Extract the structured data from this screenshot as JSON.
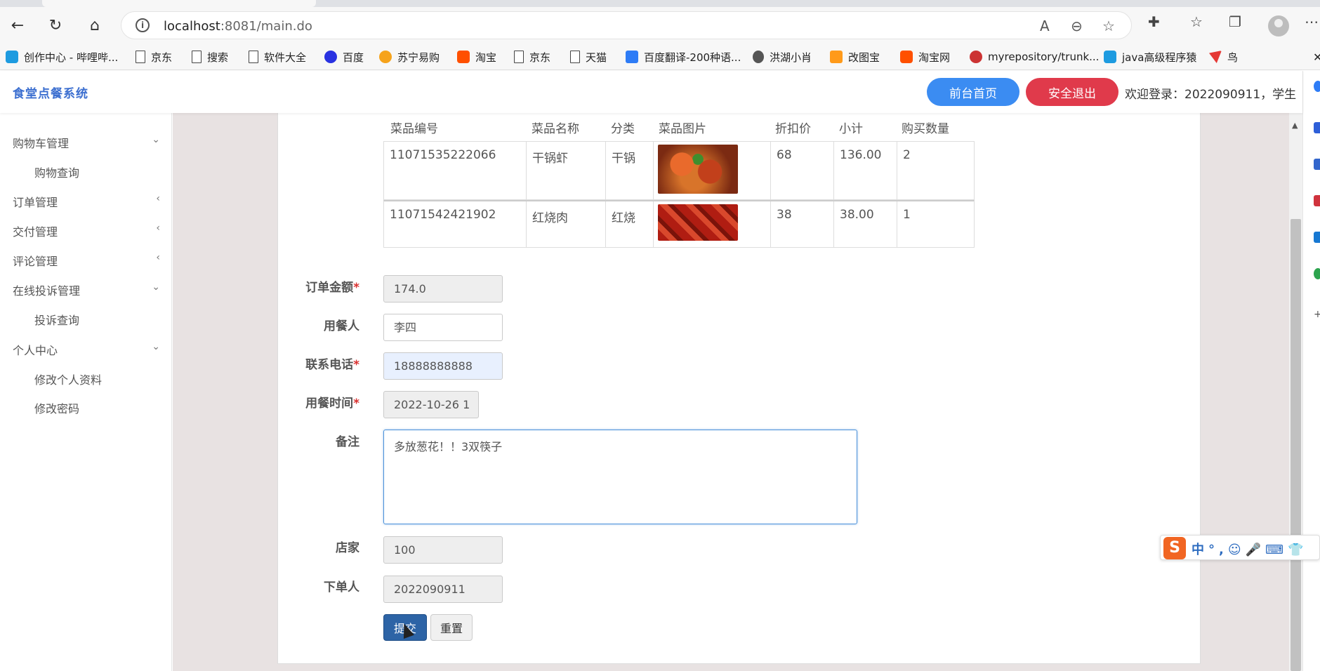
{
  "browser": {
    "url_host": "localhost",
    "url_path": ":8081/main.do",
    "bookmarks": [
      {
        "label": "创作中心 - 哔哩哔...",
        "icon": "bilibili-icon"
      },
      {
        "label": "京东",
        "icon": "page-icon"
      },
      {
        "label": "搜索",
        "icon": "page-icon"
      },
      {
        "label": "软件大全",
        "icon": "page-icon"
      },
      {
        "label": "百度",
        "icon": "baidu-icon"
      },
      {
        "label": "苏宁易购",
        "icon": "suning-icon"
      },
      {
        "label": "淘宝",
        "icon": "taobao-icon"
      },
      {
        "label": "京东",
        "icon": "page-icon"
      },
      {
        "label": "天猫",
        "icon": "page-icon"
      },
      {
        "label": "百度翻译-200种语...",
        "icon": "fanyi-icon"
      },
      {
        "label": "洪湖小肖",
        "icon": "hh-icon"
      },
      {
        "label": "改图宝",
        "icon": "gaitubao-icon"
      },
      {
        "label": "淘宝网",
        "icon": "taobao-icon"
      },
      {
        "label": "myrepository/trunk...",
        "icon": "git-icon"
      },
      {
        "label": "java高级程序猿",
        "icon": "bilibili-icon"
      },
      {
        "label": "鸟",
        "icon": "bird-icon"
      }
    ]
  },
  "header": {
    "title": "食堂点餐系统",
    "front_button": "前台首页",
    "logout_button": "安全退出",
    "welcome": "欢迎登录：2022090911，学生"
  },
  "sidebar": {
    "items": [
      {
        "label": "购物车管理",
        "chevron": "⌄"
      },
      {
        "label": "购物查询",
        "sub": true
      },
      {
        "label": "订单管理",
        "chevron": "‹"
      },
      {
        "label": "交付管理",
        "chevron": "‹"
      },
      {
        "label": "评论管理",
        "chevron": "‹"
      },
      {
        "label": "在线投诉管理",
        "chevron": "⌄"
      },
      {
        "label": "投诉查询",
        "sub": true
      },
      {
        "label": "个人中心",
        "chevron": "⌄"
      },
      {
        "label": "修改个人资料",
        "sub": true
      },
      {
        "label": "修改密码",
        "sub": true
      }
    ]
  },
  "table": {
    "headers": [
      "菜品编号",
      "菜品名称",
      "分类",
      "菜品图片",
      "折扣价",
      "小计",
      "购买数量"
    ],
    "rows": [
      {
        "code": "11071535222066",
        "name": "干锅虾",
        "category": "干锅",
        "price": "68",
        "subtotal": "136.00",
        "qty": "2"
      },
      {
        "code": "11071542421902",
        "name": "红烧肉",
        "category": "红烧",
        "price": "38",
        "subtotal": "38.00",
        "qty": "1"
      }
    ]
  },
  "form": {
    "amount_label": "订单金额",
    "amount": "174.0",
    "diner_label": "用餐人",
    "diner": "李四",
    "phone_label": "联系电话",
    "phone": "18888888888",
    "time_label": "用餐时间",
    "time": "2022-10-26 1",
    "remark_label": "备注",
    "remark": "多放葱花！！3双筷子",
    "shop_label": "店家",
    "shop": "100",
    "orderer_label": "下单人",
    "orderer": "2022090911",
    "required_mark": "*",
    "submit": "提交",
    "reset": "重置"
  },
  "ime": {
    "logo": "S",
    "mode": "中",
    "punct": "°,"
  },
  "colors": {
    "accent": "#3b8cf2",
    "danger": "#e03a4b",
    "primary_dark": "#2d64a6",
    "title": "#3c6fd0"
  }
}
